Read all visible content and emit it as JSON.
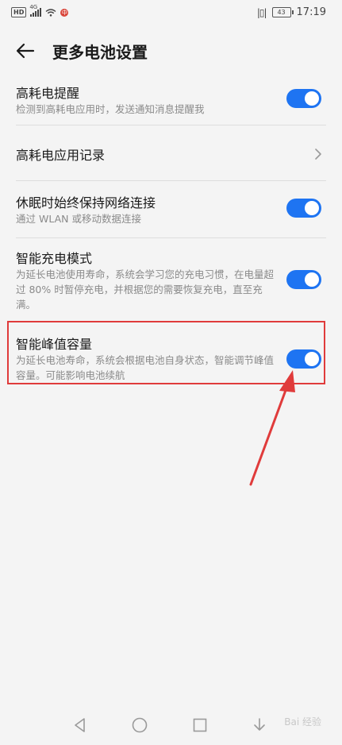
{
  "status_bar": {
    "hd": "HD",
    "signal_label": "4G",
    "app_badge": "中",
    "battery": "43",
    "time": "17:19"
  },
  "header": {
    "title": "更多电池设置"
  },
  "settings": [
    {
      "label": "高耗电提醒",
      "description": "检测到高耗电应用时，发送通知消息提醒我",
      "control": "toggle",
      "state": "on"
    },
    {
      "label": "高耗电应用记录",
      "description": "",
      "control": "chevron"
    },
    {
      "label": "休眠时始终保持网络连接",
      "description": "通过 WLAN 或移动数据连接",
      "control": "toggle",
      "state": "on"
    },
    {
      "label": "智能充电模式",
      "description": "为延长电池使用寿命，系统会学习您的充电习惯，在电量超过 80% 时暂停充电，并根据您的需要恢复充电，直至充满。",
      "control": "toggle",
      "state": "on"
    },
    {
      "label": "智能峰值容量",
      "description": "为延长电池寿命，系统会根据电池自身状态，智能调节峰值容量。可能影响电池续航",
      "control": "toggle",
      "state": "on"
    }
  ],
  "annotation": {
    "highlight_color": "#e03b3b"
  },
  "accent_color": "#1e74f2",
  "watermark": "Bai 经验"
}
